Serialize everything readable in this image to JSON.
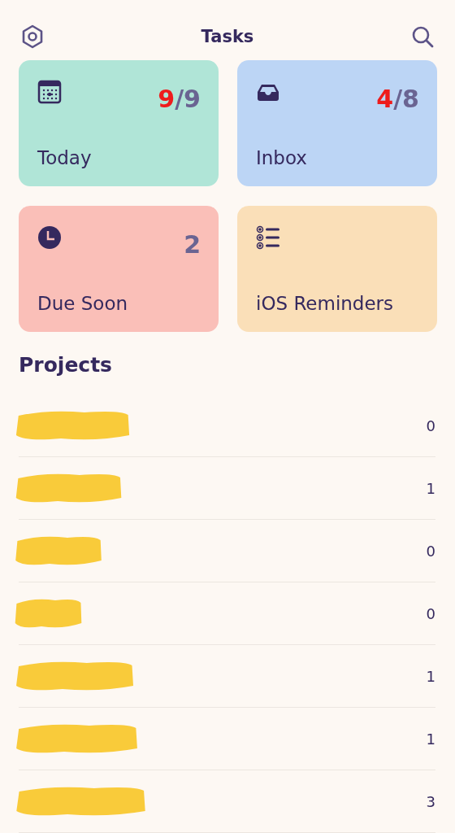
{
  "header": {
    "title": "Tasks"
  },
  "cards": [
    {
      "kind": "calendar",
      "label": "Today",
      "color": "#b0e5d7",
      "count_parts": [
        {
          "text": "9",
          "kind": "alert"
        },
        {
          "text": "/9",
          "kind": "normal"
        }
      ]
    },
    {
      "kind": "inbox",
      "label": "Inbox",
      "color": "#bcd5f5",
      "count_parts": [
        {
          "text": "4",
          "kind": "alert"
        },
        {
          "text": "/8",
          "kind": "normal"
        }
      ]
    },
    {
      "kind": "clock",
      "label": "Due Soon",
      "color": "#fabfb8",
      "count_parts": [
        {
          "text": "2",
          "kind": "normal"
        }
      ]
    },
    {
      "kind": "list",
      "label": "iOS Reminders",
      "color": "#fadfb8"
    }
  ],
  "projects": {
    "title": "Projects",
    "rows": [
      {
        "kind": "redacted",
        "count": "0"
      },
      {
        "kind": "redacted",
        "count": "1"
      },
      {
        "kind": "redacted",
        "count": "0"
      },
      {
        "kind": "redacted",
        "count": "0"
      },
      {
        "kind": "redacted",
        "count": "1"
      },
      {
        "kind": "redacted",
        "count": "1"
      },
      {
        "kind": "redacted",
        "count": "3"
      }
    ]
  }
}
